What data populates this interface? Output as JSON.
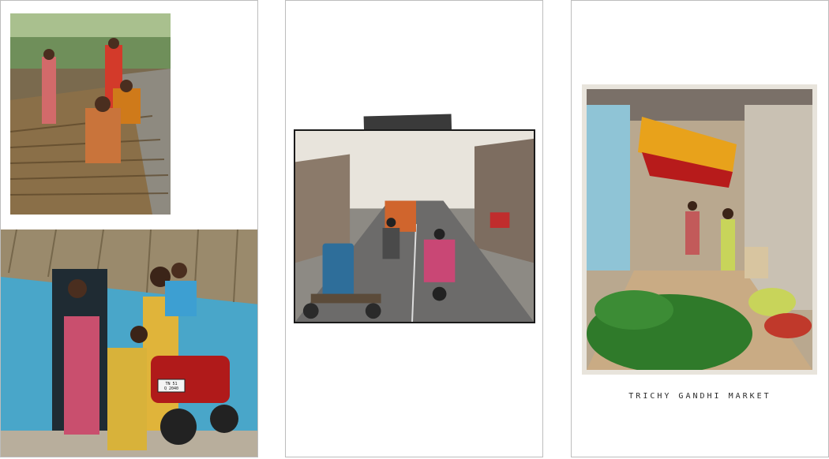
{
  "panels": {
    "left": {
      "photo_top": {
        "subject": "women weaving palm-leaf mats by a tree-lined road"
      },
      "photo_bottom": {
        "subject": "family with a red motorcycle outside a blue thatched house",
        "plate_text": "TN 51\nQ 2040"
      }
    },
    "middle": {
      "photo": {
        "subject": "busy town street with motorbikes, a bus and a blue drum on a cart"
      }
    },
    "right": {
      "photo": {
        "subject": "narrow market lane with an orange awning and piles of greens"
      },
      "caption": "TRICHY GANDHI MARKET"
    }
  },
  "colors": {
    "panel_border": "#bdbdbd",
    "tape": "#3a3a3a",
    "awning": "#e8a21b",
    "house_blue": "#49a6c9"
  }
}
